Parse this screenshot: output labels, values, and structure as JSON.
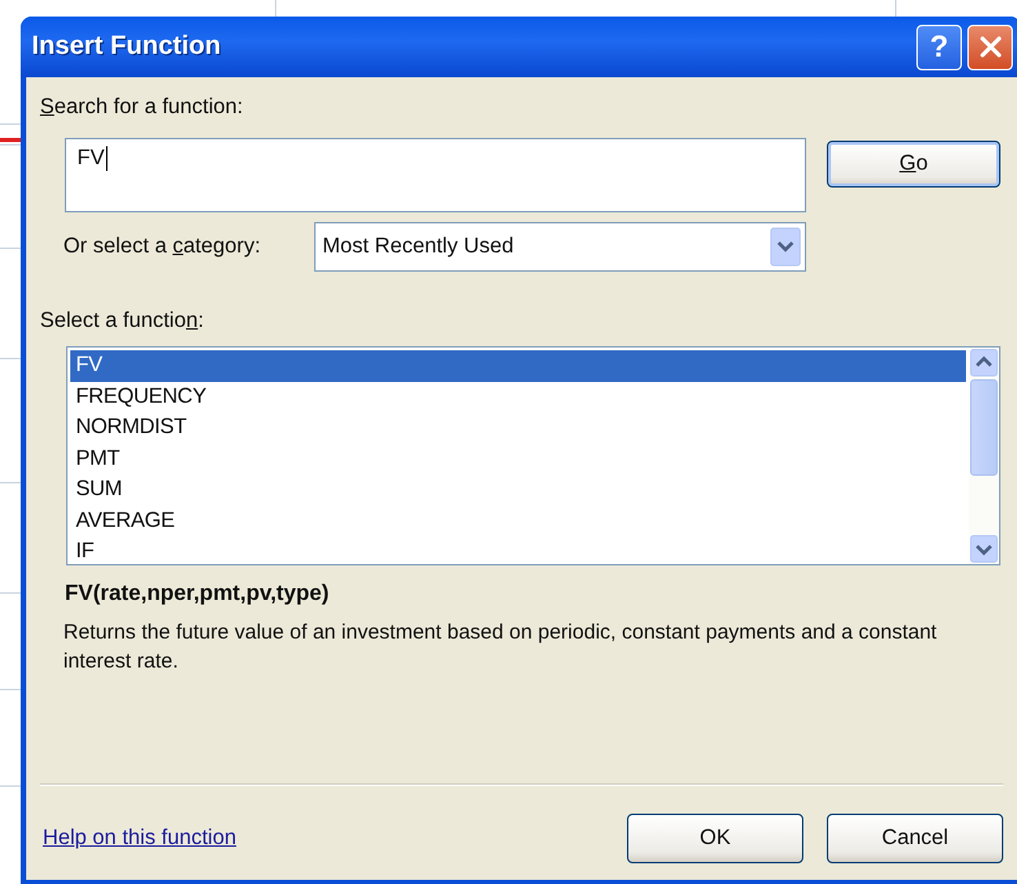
{
  "window": {
    "title": "Insert Function",
    "help_glyph": "?"
  },
  "search": {
    "label": {
      "key": "S",
      "post": "earch for a function:"
    },
    "value": "FV"
  },
  "go_button": {
    "key": "G",
    "post": "o"
  },
  "category": {
    "label": {
      "pre": "Or select a ",
      "key": "c",
      "post": "ategory:"
    },
    "value": "Most Recently Used"
  },
  "function_list": {
    "label": {
      "pre": "Select a functio",
      "key": "n",
      "post": ":"
    },
    "items": [
      {
        "name": "FV",
        "selected": true
      },
      {
        "name": "FREQUENCY",
        "selected": false
      },
      {
        "name": "NORMDIST",
        "selected": false
      },
      {
        "name": "PMT",
        "selected": false
      },
      {
        "name": "SUM",
        "selected": false
      },
      {
        "name": "AVERAGE",
        "selected": false
      },
      {
        "name": "IF",
        "selected": false
      }
    ]
  },
  "signature": "FV(rate,nper,pmt,pv,type)",
  "description": "Returns the future value of an investment based on periodic, constant payments and a constant interest rate.",
  "help_link": "Help on this function",
  "buttons": [
    "OK",
    "Cancel"
  ]
}
